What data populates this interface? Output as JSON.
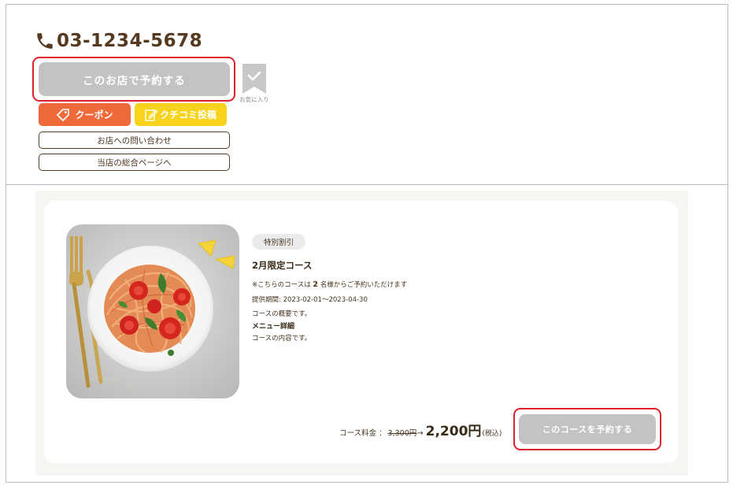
{
  "shop": {
    "phone": "03-1234-5678",
    "reserve_label": "このお店で予約する",
    "favorite_label": "お気に入り",
    "coupon_label": "クーポン",
    "review_label": "クチコミ投稿",
    "inquiry_label": "お店への問い合わせ",
    "overview_label": "当店の総合ページへ"
  },
  "course": {
    "badge": "特別割引",
    "title": "2月限定コース",
    "note_prefix": "※こちらのコースは",
    "note_count": "2",
    "note_suffix": "名様からご予約いただけます",
    "period": "提供期間: 2023-02-01～2023-04-30",
    "summary": "コースの概要です。",
    "menu_heading": "メニュー詳細",
    "menu_body": "コースの内容です。",
    "price_label": "コース料金 ：",
    "price_old": "3,300円",
    "price_arrow": "→",
    "price_new": "2,200円",
    "price_tax": "(税込)",
    "reserve_label": "このコースを予約する"
  },
  "colors": {
    "brand_brown": "#553a1f",
    "highlight_red": "#e0202a",
    "coupon_orange": "#ef6a3a",
    "review_yellow": "#f8d31e",
    "disabled_gray": "#c3c3c3"
  },
  "icons": [
    "phone-icon",
    "bookmark-icon",
    "tag-icon",
    "edit-icon"
  ]
}
